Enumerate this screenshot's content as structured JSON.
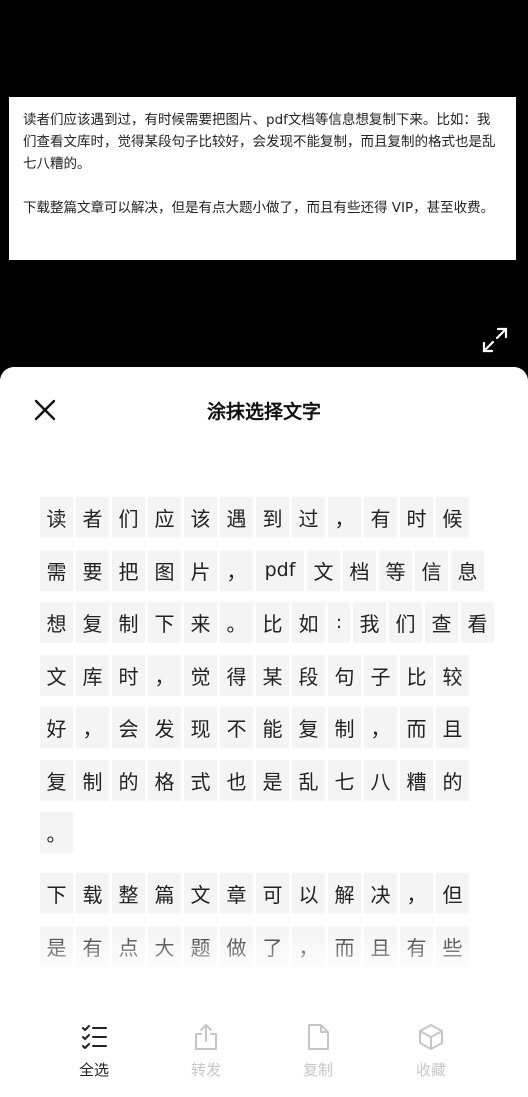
{
  "document": {
    "paragraph1": "读者们应该遇到过，有时候需要把图片、pdf文档等信息想复制下来。比如：我们查看文库时，觉得某段句子比较好，会发现不能复制，而且复制的格式也是乱七八糟的。",
    "paragraph2": "下载整篇文章可以解决，但是有点大题小做了，而且有些还得 VIP，甚至收费。"
  },
  "icons": {
    "expand": "expand-icon",
    "close": "close-icon",
    "select_all": "list-check-icon",
    "share": "share-icon",
    "copy": "document-icon",
    "favorite": "cube-icon"
  },
  "sheet": {
    "title": "涂抹选择文字",
    "rows": [
      [
        "读",
        "者",
        "们",
        "应",
        "该",
        "遇",
        "到",
        "过",
        "，",
        "有",
        "时",
        "候"
      ],
      [
        "需",
        "要",
        "把",
        "图",
        "片",
        "，",
        "pdf",
        "文",
        "档",
        "等",
        "信",
        "息"
      ],
      [
        "想",
        "复",
        "制",
        "下",
        "来",
        "。",
        "比",
        "如",
        ":",
        "我",
        "们",
        "查",
        "看"
      ],
      [
        "文",
        "库",
        "时",
        "，",
        "觉",
        "得",
        "某",
        "段",
        "句",
        "子",
        "比",
        "较"
      ],
      [
        "好",
        "，",
        "会",
        "发",
        "现",
        "不",
        "能",
        "复",
        "制",
        "，",
        "而",
        "且"
      ],
      [
        "复",
        "制",
        "的",
        "格",
        "式",
        "也",
        "是",
        "乱",
        "七",
        "八",
        "糟",
        "的"
      ],
      [
        "。"
      ],
      [
        "下",
        "载",
        "整",
        "篇",
        "文",
        "章",
        "可",
        "以",
        "解",
        "决",
        "，",
        "但"
      ],
      [
        "是",
        "有",
        "点",
        "大",
        "题",
        "做",
        "了",
        "，",
        "而",
        "且",
        "有",
        "些"
      ]
    ]
  },
  "toolbar": {
    "select_all_label": "全选",
    "share_label": "转发",
    "copy_label": "复制",
    "favorite_label": "收藏"
  },
  "colors": {
    "background": "#000000",
    "sheet": "#ffffff",
    "char_cell": "#f4f4f4",
    "disabled": "#c6c6c6"
  }
}
